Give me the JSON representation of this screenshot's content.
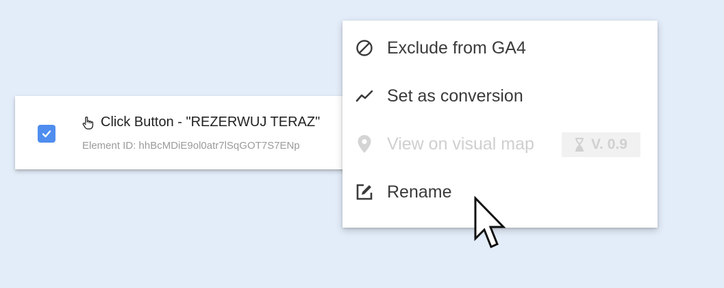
{
  "event_card": {
    "checked": true,
    "icon": "pointer-hand-icon",
    "title": "Click Button - \"REZERWUJ TERAZ\"",
    "element_id_text": "Element ID: hhBcMDiE9ol0atr7lSqGOT7S7ENp"
  },
  "context_menu": {
    "items": [
      {
        "label": "Exclude from GA4",
        "icon": "block-icon",
        "enabled": true
      },
      {
        "label": "Set as conversion",
        "icon": "trend-line-icon",
        "enabled": true
      },
      {
        "label": "View on visual map",
        "icon": "location-pin-icon",
        "enabled": false,
        "badge": "V. 0.9",
        "badge_icon": "hourglass-icon"
      },
      {
        "label": "Rename",
        "icon": "edit-icon",
        "enabled": true
      }
    ]
  },
  "colors": {
    "background": "#e3edf9",
    "checkbox": "#4f8def",
    "menu_text": "#3a3a3a",
    "disabled_text": "#cfcfcf"
  }
}
